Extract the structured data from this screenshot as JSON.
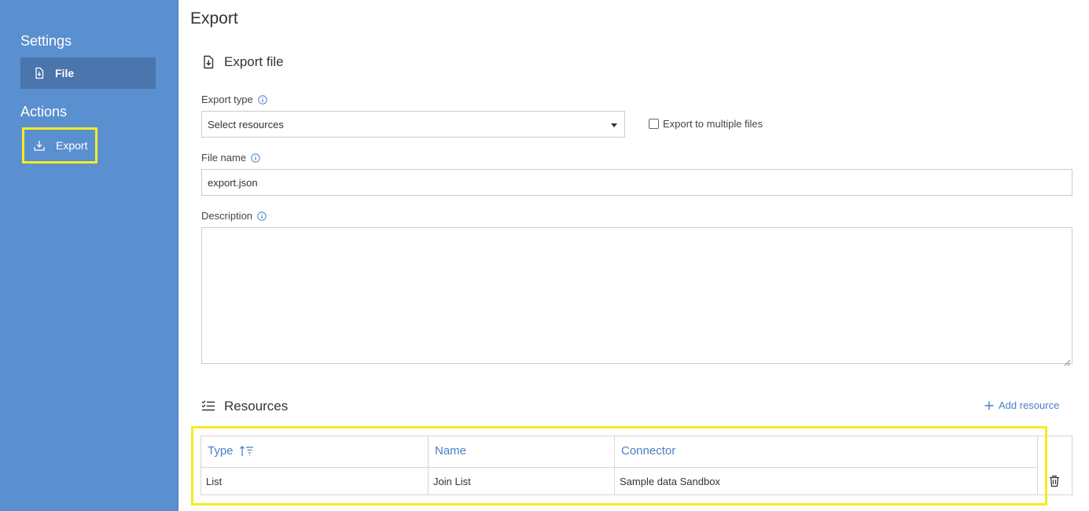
{
  "sidebar": {
    "settings_heading": "Settings",
    "file_label": "File",
    "actions_heading": "Actions",
    "export_label": "Export"
  },
  "main": {
    "page_title": "Export",
    "export_file_title": "Export file",
    "export_type_label": "Export type",
    "export_type_value": "Select resources",
    "multiple_files_label": "Export to multiple files",
    "file_name_label": "File name",
    "file_name_value": "export.json",
    "description_label": "Description",
    "resources_title": "Resources",
    "add_resource_label": "Add resource"
  },
  "table": {
    "headers": [
      "Type",
      "Name",
      "Connector"
    ],
    "rows": [
      {
        "type": "List",
        "name": "Join List",
        "connector": "Sample data Sandbox"
      }
    ]
  },
  "colors": {
    "sidebar": "#5a8fd0",
    "accent": "#4a7fc4",
    "highlight": "#f4ec1f"
  }
}
